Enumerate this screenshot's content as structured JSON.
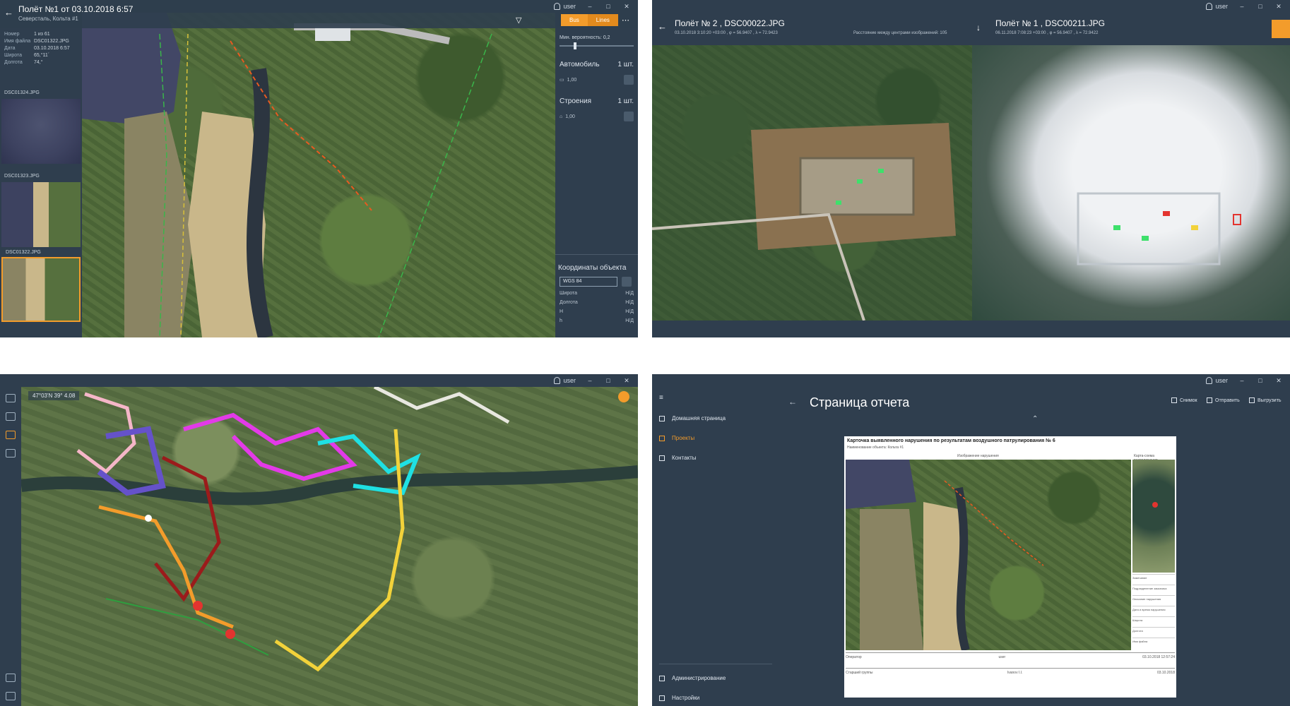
{
  "user_label": "user",
  "p1": {
    "title": "Полёт №1 от 03.10.2018 6:57",
    "subtitle": "Северсталь, Кольта #1",
    "meta": [
      {
        "k": "Номер",
        "v": "1 из 61"
      },
      {
        "k": "Имя файла",
        "v": "DSC01322.JPG"
      },
      {
        "k": "Дата",
        "v": "03.10.2018 6:57"
      },
      {
        "k": "Широта",
        "v": "65,°11´"
      },
      {
        "k": "Долгота",
        "v": "74,°"
      }
    ],
    "thumbs": [
      "DSC01324.JPG",
      "DSC01323.JPG",
      "DSC01322.JPG"
    ],
    "seg": [
      "Bus",
      "Lines"
    ],
    "min_prob_label": "Мин. вероятность: 0,2",
    "cats": [
      {
        "name": "Автомобиль",
        "count": "1 шт.",
        "score": "1,00"
      },
      {
        "name": "Строения",
        "count": "1 шт.",
        "score": "1,00"
      }
    ],
    "coords_title": "Координаты объекта",
    "crs": "WGS 84",
    "coords": [
      {
        "k": "Широта",
        "v": "Н/Д"
      },
      {
        "k": "Долгота",
        "v": "Н/Д"
      },
      {
        "k": "H",
        "v": "Н/Д"
      },
      {
        "k": "h",
        "v": "Н/Д"
      }
    ]
  },
  "p2": {
    "left_title": "Полёт  № 2 , DSC00022.JPG",
    "left_sub": "03.10.2018 3:10:20 +03:00 , φ = 56.9407 , λ = 72.9423",
    "mid_sub": "Расстояние между центрами изображений: 105",
    "right_title": "Полёт  № 1 , DSC00211.JPG",
    "right_sub": "06.11.2018 7:08:23 +03:00 , φ = 56.9407 , λ = 72.9422"
  },
  "p3": {
    "coord": "47°03'N  39°  4.08"
  },
  "p4": {
    "nav": [
      {
        "label": "Домашняя страница"
      },
      {
        "label": "Проекты"
      },
      {
        "label": "Контакты"
      }
    ],
    "nav_bottom": [
      {
        "label": "Администрирование"
      },
      {
        "label": "Настройки"
      }
    ],
    "page_title": "Страница отчета",
    "toolbar": [
      "Снимок",
      "Отправить",
      "Выгрузить"
    ],
    "card_title": "Карточка выявленного нарушения по результатам воздушного патрулирования № 6",
    "card_sub": "Наименование объекта: Кольта #1",
    "col1": "Изображение нарушения",
    "col2": "Карта-схема расположения нарушения",
    "fields": [
      "Замечание",
      "Подразделение заказчика",
      "Описание нарушения",
      "Дата и время нарушения",
      "Широта",
      "Долгота",
      "Имя файла"
    ],
    "footer": [
      {
        "k": "Оператор",
        "v": "user",
        "d": "03.10.2018 12:57:24"
      },
      {
        "k": "Старший группы",
        "v": "Ivanov I.I.",
        "d": "03.10.2018"
      }
    ]
  }
}
